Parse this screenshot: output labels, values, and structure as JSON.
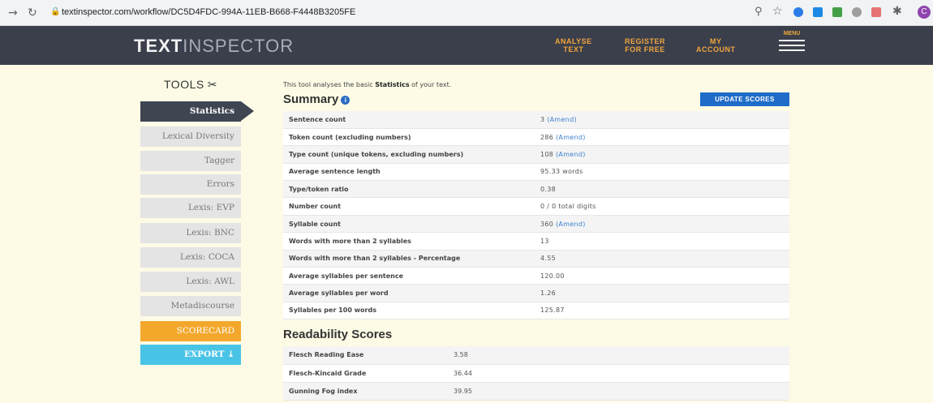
{
  "browser": {
    "url": "textinspector.com/workflow/DC5D4FDC-994A-11EB-B668-F4448B3205FE",
    "back_icon": "arrow-right-icon",
    "reload_icon": "reload-icon",
    "profile_initial": "C"
  },
  "header": {
    "logo_bold": "TEXT",
    "logo_light": "INSPECTOR",
    "nav": [
      {
        "line1": "ANALYSE",
        "line2": "TEXT"
      },
      {
        "line1": "REGISTER",
        "line2": "FOR FREE"
      },
      {
        "line1": "MY",
        "line2": "ACCOUNT"
      }
    ],
    "menu_label": "MENU"
  },
  "sidebar": {
    "title": "TOOLS",
    "items": [
      {
        "label": "Statistics",
        "state": "active"
      },
      {
        "label": "Lexical Diversity"
      },
      {
        "label": "Tagger"
      },
      {
        "label": "Errors"
      },
      {
        "label": "Lexis: EVP"
      },
      {
        "label": "Lexis: BNC"
      },
      {
        "label": "Lexis: COCA"
      },
      {
        "label": "Lexis: AWL"
      },
      {
        "label": "Metadiscourse"
      },
      {
        "label": "SCORECARD"
      },
      {
        "label": "EXPORT"
      }
    ]
  },
  "main": {
    "intro_prefix": "This tool analyses the basic",
    "intro_bold": "Statistics",
    "intro_suffix": "of your text.",
    "summary_title": "Summary",
    "update_button": "UPDATE SCORES",
    "amend_label": "(Amend)",
    "stats": [
      {
        "label": "Sentence count",
        "value": "3",
        "amend": true
      },
      {
        "label": "Token count (excluding numbers)",
        "value": "286",
        "amend": true
      },
      {
        "label": "Type count (unique tokens, excluding numbers)",
        "value": "108",
        "amend": true
      },
      {
        "label": "Average sentence length",
        "value": "95.33 words"
      },
      {
        "label": "Type/token ratio",
        "value": "0.38"
      },
      {
        "label": "Number count",
        "value": "0 / 0 total digits"
      },
      {
        "label": "Syllable count",
        "value": "360",
        "amend": true
      },
      {
        "label": "Words with more than 2 syllables",
        "value": "13"
      },
      {
        "label": "Words with more than 2 syllables - Percentage",
        "value": "4.55"
      },
      {
        "label": "Average syllables per sentence",
        "value": "120.00"
      },
      {
        "label": "Average syllables per word",
        "value": "1.26"
      },
      {
        "label": "Syllables per 100 words",
        "value": "125.87"
      }
    ],
    "readability_title": "Readability Scores",
    "readability": [
      {
        "label": "Flesch Reading Ease",
        "value": "3.58"
      },
      {
        "label": "Flesch-Kincaid Grade",
        "value": "36.44"
      },
      {
        "label": "Gunning Fog index",
        "value": "39.95"
      }
    ]
  },
  "colors": {
    "header_bg": "#3b3f4c",
    "accent_orange": "#f0a63b",
    "update_blue": "#1e6cc8",
    "export_cyan": "#4ac4e6",
    "page_bg": "#fdfbe6"
  }
}
